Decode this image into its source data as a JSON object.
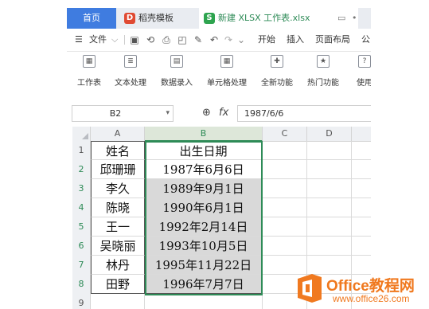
{
  "tabs": {
    "home": "首页",
    "doc1": "稻壳模板",
    "doc2": "新建 XLSX 工作表.xlsx"
  },
  "menubar": {
    "file": "文件",
    "items": [
      "开始",
      "插入",
      "页面布局",
      "公"
    ]
  },
  "ribbon": {
    "buttons": [
      "工作表",
      "文本处理",
      "数据录入",
      "单元格处理",
      "全新功能",
      "热门功能",
      "使用"
    ]
  },
  "formula_bar": {
    "name_box": "B2",
    "fx": "fx",
    "value": "1987/6/6"
  },
  "sheet": {
    "columns": [
      "A",
      "B",
      "C",
      "D"
    ],
    "rows": [
      "1",
      "2",
      "3",
      "4",
      "5",
      "6",
      "7",
      "8",
      "9"
    ],
    "header": {
      "a": "姓名",
      "b": "出生日期"
    },
    "data": [
      {
        "name": "邱珊珊",
        "date": "1987年6月6日"
      },
      {
        "name": "李久",
        "date": "1989年9月1日"
      },
      {
        "name": "陈晓",
        "date": "1990年6月1日"
      },
      {
        "name": "王一",
        "date": "1992年2月14日"
      },
      {
        "name": "吴晓丽",
        "date": "1993年10月5日"
      },
      {
        "name": "林丹",
        "date": "1995年11月22日"
      },
      {
        "name": "田野",
        "date": "1996年7月7日"
      }
    ]
  },
  "watermark": {
    "title": "Office教程网",
    "url": "www.office26.com"
  }
}
